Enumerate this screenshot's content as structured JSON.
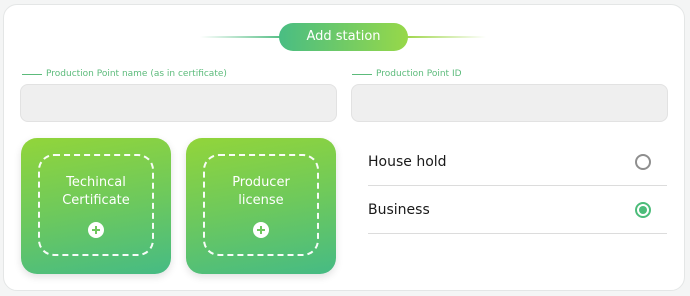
{
  "header": {
    "title": "Add station"
  },
  "fields": {
    "name": {
      "label": "Production Point name (as in certificate)",
      "value": ""
    },
    "id": {
      "label": "Production Point ID",
      "value": ""
    }
  },
  "uploads": [
    {
      "label": "Techincal Certificate",
      "icon": "plus-icon"
    },
    {
      "label": "Producer license",
      "icon": "plus-icon"
    }
  ],
  "type_options": [
    {
      "label": "House hold",
      "selected": false
    },
    {
      "label": "Business",
      "selected": true
    }
  ],
  "colors": {
    "accent_green": "#4cbc7a",
    "accent_lime": "#97d849"
  }
}
